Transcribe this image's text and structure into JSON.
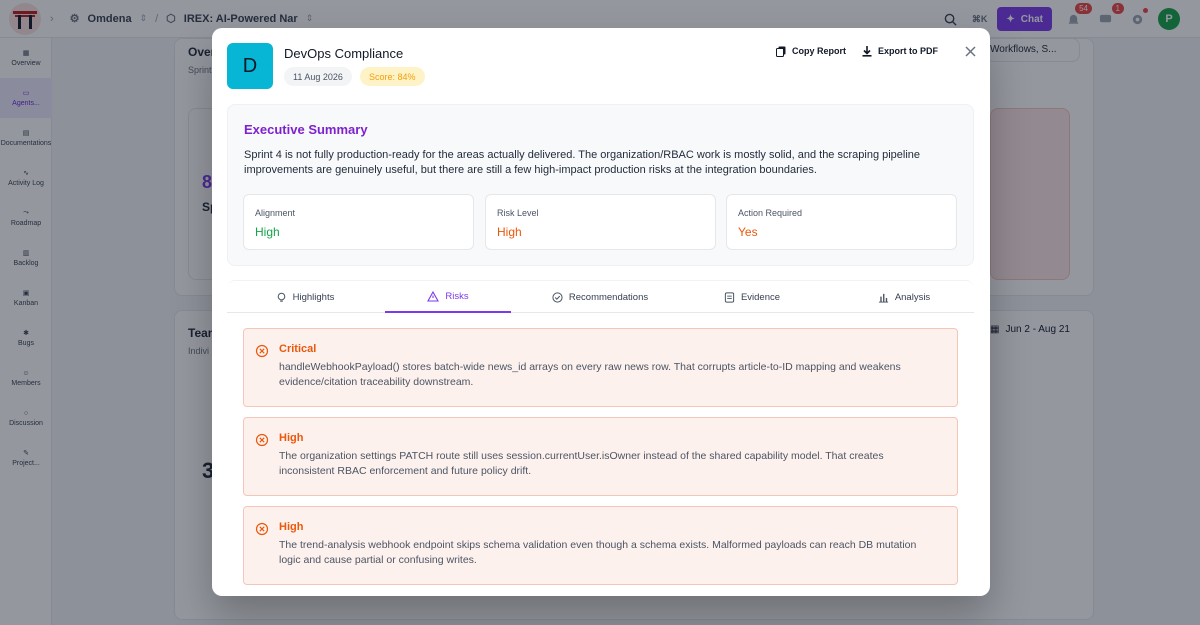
{
  "topbar": {
    "org": "Omdena",
    "project": "IREX: AI-Powered Nar",
    "kbd": "⌘K",
    "chat_label": "Chat",
    "notif_count": "54",
    "msg_count": "1",
    "avatar_initial": "P"
  },
  "sidebar": {
    "items": [
      {
        "label": "Overview",
        "icon": "grid-icon"
      },
      {
        "label": "Agents...",
        "icon": "agent-message-icon"
      },
      {
        "label": "Documentations",
        "icon": "document-icon"
      },
      {
        "label": "Activity Log",
        "icon": "activity-icon"
      },
      {
        "label": "Roadmap",
        "icon": "roadmap-icon"
      },
      {
        "label": "Backlog",
        "icon": "backlog-icon"
      },
      {
        "label": "Kanban",
        "icon": "kanban-icon"
      },
      {
        "label": "Bugs",
        "icon": "bug-icon"
      },
      {
        "label": "Members",
        "icon": "members-icon"
      },
      {
        "label": "Discussion",
        "icon": "discussion-icon"
      },
      {
        "label": "Project...",
        "icon": "pencil-icon"
      }
    ]
  },
  "background": {
    "overview_title": "Over",
    "overview_sub": "Sprint",
    "workflows_select": "Workflows, S...",
    "team_title": "Tean",
    "team_sub": "Indivi",
    "date_range": "Jun 2 - Aug 21",
    "big_number": "8",
    "big_number_2": "3",
    "sp_text": "Sp"
  },
  "modal": {
    "avatar_letter": "D",
    "title": "DevOps Compliance",
    "date": "11 Aug 2026",
    "score": "Score: 84%",
    "copy_report": "Copy Report",
    "export_pdf": "Export to PDF",
    "summary": {
      "title": "Executive Summary",
      "body": "Sprint 4 is not fully production-ready for the areas actually delivered. The organization/RBAC work is mostly solid, and the scraping pipeline improvements are genuinely useful, but there are still a few high-impact production risks at the integration boundaries.",
      "metrics": [
        {
          "label": "Alignment",
          "value": "High"
        },
        {
          "label": "Risk Level",
          "value": "High"
        },
        {
          "label": "Action Required",
          "value": "Yes"
        }
      ]
    },
    "tabs": [
      {
        "label": "Highlights"
      },
      {
        "label": "Risks"
      },
      {
        "label": "Recommendations"
      },
      {
        "label": "Evidence"
      },
      {
        "label": "Analysis"
      }
    ],
    "risks": [
      {
        "severity": "Critical",
        "text": "handleWebhookPayload() stores batch-wide news_id arrays on every raw news row. That corrupts article-to-ID mapping and weakens evidence/citation traceability downstream."
      },
      {
        "severity": "High",
        "text": "The organization settings PATCH route still uses session.currentUser.isOwner instead of the shared capability model. That creates inconsistent RBAC enforcement and future policy drift."
      },
      {
        "severity": "High",
        "text": "The trend-analysis webhook endpoint skips schema validation even though a schema exists. Malformed payloads can reach DB mutation logic and cause partial or confusing writes."
      }
    ]
  },
  "colors": {
    "accent": "#7c3aed",
    "risk_orange": "#ea580c",
    "success_green": "#16a34a",
    "avatar_cyan": "#06b6d4"
  }
}
